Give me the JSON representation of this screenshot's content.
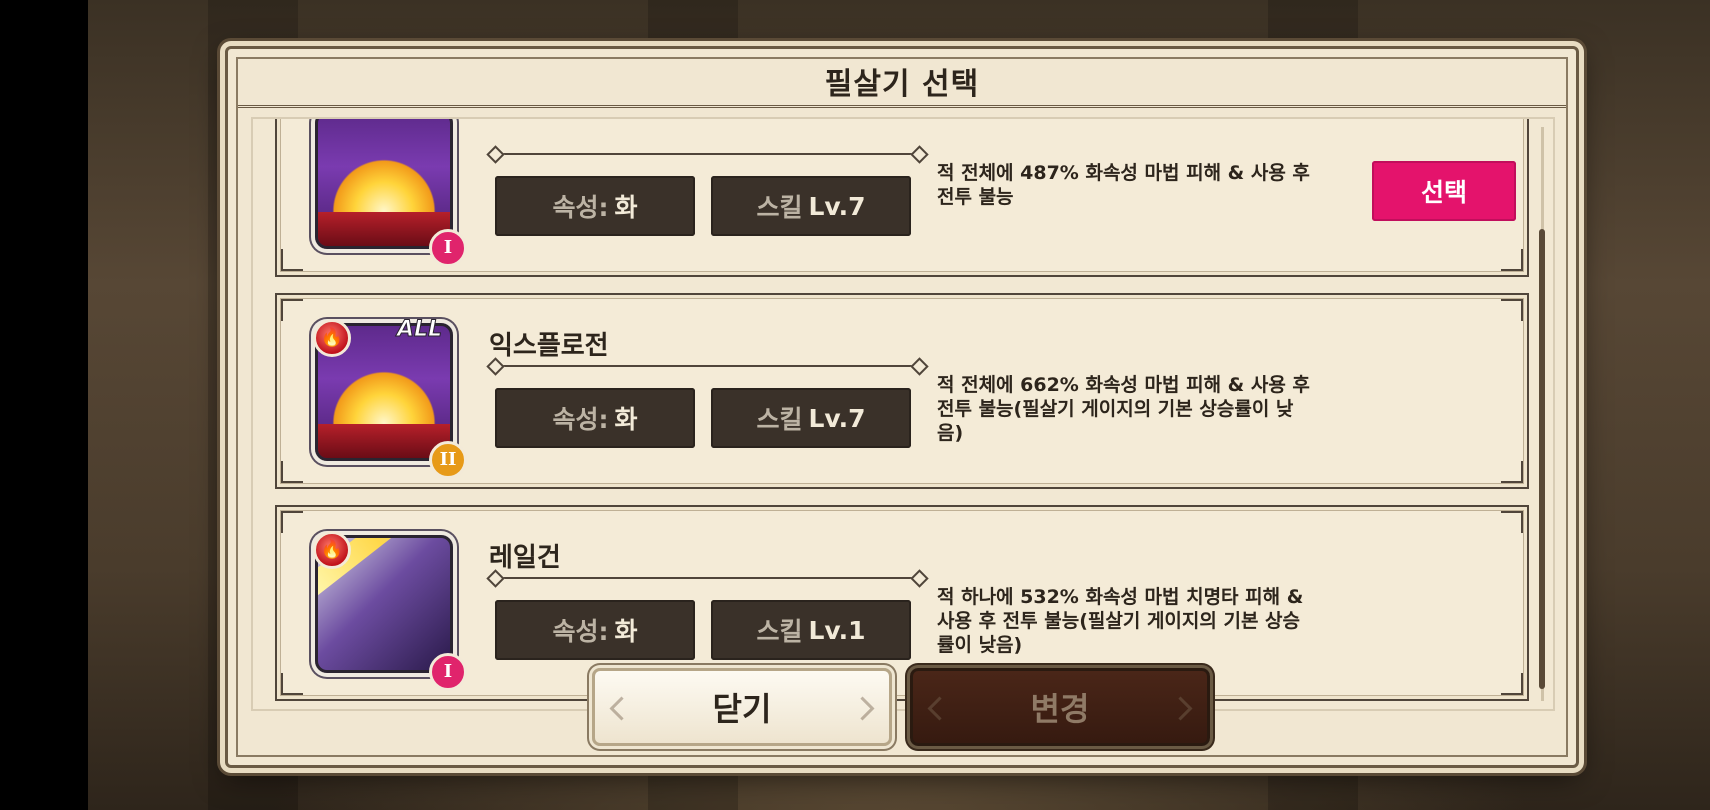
{
  "dialog": {
    "title": "필살기 선택"
  },
  "skills": [
    {
      "name": "",
      "attribute_key": "속성:",
      "attribute_value": "화",
      "level_key": "스킬",
      "level_value": "Lv.7",
      "description": "적 전체에 487% 화속성 마법 피해 & 사용 후 전투 불능",
      "rank": "I",
      "target_badge": "",
      "select_label": "선택"
    },
    {
      "name": "익스플로전",
      "attribute_key": "속성:",
      "attribute_value": "화",
      "level_key": "스킬",
      "level_value": "Lv.7",
      "description": "적 전체에 662% 화속성 마법 피해 & 사용 후 전투 불능(필살기 게이지의 기본 상승률이 낮음)",
      "rank": "II",
      "target_badge": "ALL"
    },
    {
      "name": "레일건",
      "attribute_key": "속성:",
      "attribute_value": "화",
      "level_key": "스킬",
      "level_value": "Lv.1",
      "description": "적 하나에 532% 화속성 마법 치명타 피해 & 사용 후 전투 불능(필살기 게이지의 기본 상승률이 낮음)",
      "rank": "I",
      "target_badge": ""
    }
  ],
  "footer": {
    "close_label": "닫기",
    "change_label": "변경"
  },
  "icons": {
    "fire": "fire-element-icon"
  },
  "colors": {
    "select_accent": "#e4136c",
    "rank_one": "#e0246c",
    "rank_two": "#e79a18"
  }
}
